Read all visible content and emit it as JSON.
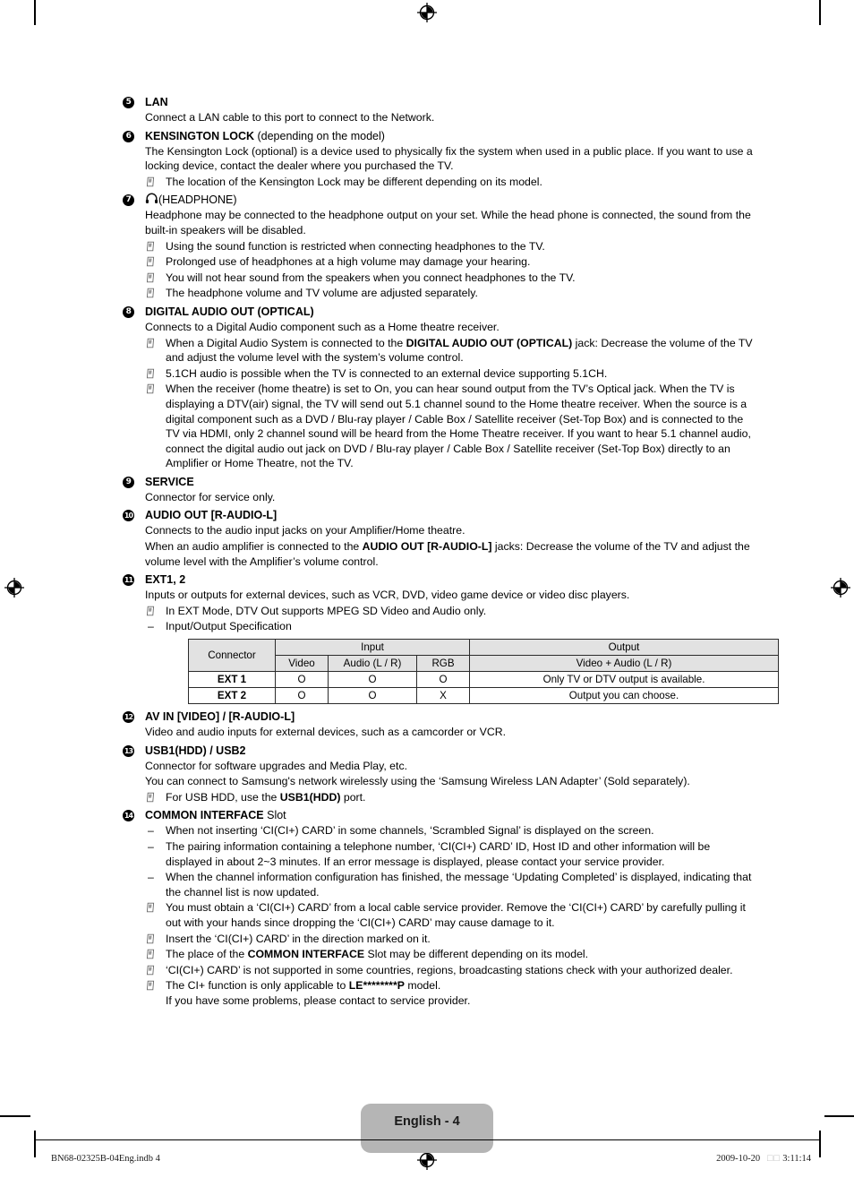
{
  "page": {
    "badge_label": "English - 4",
    "footer_left": "BN68-02325B-04Eng.indb   4",
    "footer_right_date": "2009-10-20",
    "footer_right_time": "3:11:14",
    "footer_right_ampm": "□□"
  },
  "sections": [
    {
      "number": "5",
      "title_bold": "LAN",
      "title_rest": "",
      "lines": [
        {
          "kind": "para",
          "text": "Connect a LAN cable to this port to connect to the Network."
        }
      ]
    },
    {
      "number": "6",
      "title_bold": "KENSINGTON LOCK",
      "title_rest": " (depending on the model)",
      "lines": [
        {
          "kind": "para",
          "text": "The Kensington Lock (optional) is a device used to physically fix the system when used in a public place. If you want to use a locking device, contact the dealer where you purchased the TV."
        },
        {
          "kind": "note",
          "text": "The location of the Kensington Lock may be different depending on its model."
        }
      ]
    },
    {
      "number": "7",
      "title_icon": "headphone-icon",
      "title_bold": "",
      "title_rest": "(HEADPHONE)",
      "lines": [
        {
          "kind": "para",
          "text": "Headphone may be connected to the headphone output on your set. While the head phone is connected, the sound from the built-in speakers will be disabled."
        },
        {
          "kind": "note",
          "text": "Using the sound function is restricted when connecting headphones to the TV."
        },
        {
          "kind": "note",
          "text": "Prolonged use of headphones at a high volume may damage your hearing."
        },
        {
          "kind": "note",
          "text": "You will not hear sound from the speakers when you connect headphones to the TV."
        },
        {
          "kind": "note",
          "text": "The headphone volume and TV volume are adjusted separately."
        }
      ]
    },
    {
      "number": "8",
      "title_bold": "DIGITAL AUDIO OUT (OPTICAL)",
      "title_rest": "",
      "lines": [
        {
          "kind": "para",
          "text": "Connects to a Digital Audio component such as a Home theatre receiver."
        },
        {
          "kind": "note",
          "html": "When a Digital Audio System is connected to the <b>DIGITAL AUDIO OUT (OPTICAL)</b> jack: Decrease the volume of the TV and adjust the volume level with the system’s volume control."
        },
        {
          "kind": "note",
          "text": "5.1CH audio is possible when the TV is connected to an external device supporting 5.1CH."
        },
        {
          "kind": "note",
          "text": "When the receiver (home theatre) is set to On, you can hear sound output from the TV’s Optical jack. When the TV is displaying a DTV(air) signal, the TV will send out 5.1 channel sound to the Home theatre receiver. When the source is a digital component such as a DVD / Blu-ray player / Cable Box / Satellite receiver (Set-Top Box) and is connected to the TV via HDMI, only 2 channel sound will be heard from the Home Theatre receiver. If you want to hear 5.1 channel audio, connect the digital audio out jack on DVD / Blu-ray player / Cable Box / Satellite receiver (Set-Top Box) directly to an Amplifier or Home Theatre, not the TV."
        }
      ]
    },
    {
      "number": "9",
      "title_bold": "SERVICE",
      "title_rest": "",
      "lines": [
        {
          "kind": "para",
          "text": "Connector for service only."
        }
      ]
    },
    {
      "number": "10",
      "title_bold": "AUDIO OUT [R-AUDIO-L]",
      "title_rest": "",
      "lines": [
        {
          "kind": "para",
          "text": "Connects to the audio input jacks on your Amplifier/Home theatre."
        },
        {
          "kind": "para",
          "html": "When an audio amplifier is connected to the <b>AUDIO OUT [R-AUDIO-L]</b> jacks: Decrease the volume of the TV and adjust the volume level with the Amplifier’s volume control."
        }
      ]
    },
    {
      "number": "11",
      "title_bold": "EXT1, 2",
      "title_rest": "",
      "lines": [
        {
          "kind": "para",
          "text": "Inputs or outputs for external devices, such as VCR, DVD, video game device or video disc players."
        },
        {
          "kind": "note",
          "text": "In EXT Mode, DTV Out supports MPEG SD Video and Audio only."
        },
        {
          "kind": "dash",
          "text": "Input/Output Specification"
        },
        {
          "kind": "table"
        }
      ]
    },
    {
      "number": "12",
      "title_bold": "AV IN [VIDEO] / [R-AUDIO-L]",
      "title_rest": "",
      "lines": [
        {
          "kind": "para",
          "text": "Video and audio inputs for external devices, such as a camcorder or VCR."
        }
      ]
    },
    {
      "number": "13",
      "title_bold": "USB1(HDD) / USB2",
      "title_rest": "",
      "lines": [
        {
          "kind": "para",
          "text": "Connector for software upgrades and Media Play, etc."
        },
        {
          "kind": "para",
          "text": "You can connect to Samsung's network wirelessly using the ‘Samsung Wireless LAN Adapter’ (Sold separately)."
        },
        {
          "kind": "note",
          "html": "For USB HDD, use the <b>USB1(HDD)</b> port."
        }
      ]
    },
    {
      "number": "14",
      "title_bold": "COMMON INTERFACE",
      "title_rest": " Slot",
      "lines": [
        {
          "kind": "dash",
          "text": "When not inserting ‘CI(CI+) CARD’ in some channels, ‘Scrambled Signal’ is displayed on the screen."
        },
        {
          "kind": "dash",
          "text": "The pairing information containing a telephone number, ‘CI(CI+) CARD’ ID, Host ID and other information will be displayed in about 2~3 minutes. If an error message is displayed, please contact your service provider."
        },
        {
          "kind": "dash",
          "text": "When the channel information configuration has finished, the message ‘Updating Completed’ is displayed, indicating that the channel list is now updated."
        },
        {
          "kind": "note",
          "text": "You must obtain a ‘CI(CI+) CARD’ from a local cable service provider. Remove the ‘CI(CI+) CARD’ by carefully pulling it out with your hands since dropping the ‘CI(CI+) CARD’ may cause damage to it."
        },
        {
          "kind": "note",
          "text": "Insert the ‘CI(CI+) CARD’ in the direction marked on it."
        },
        {
          "kind": "note",
          "html": "The place of the <b>COMMON INTERFACE</b> Slot may be different depending on its model."
        },
        {
          "kind": "note",
          "text": "‘CI(CI+) CARD’ is not supported in some countries, regions, broadcasting stations check with your authorized dealer."
        },
        {
          "kind": "note",
          "html": "The CI+ function is only applicable to <b>LE********P</b> model.<br>If you have some problems, please contact to service provider."
        }
      ]
    }
  ],
  "spec_table": {
    "group_headers": [
      "Connector",
      "Input",
      "Output"
    ],
    "sub_headers": [
      "Video",
      "Audio (L / R)",
      "RGB",
      "Video + Audio (L / R)"
    ],
    "rows": [
      {
        "connector": "EXT 1",
        "video": "O",
        "audio": "O",
        "rgb": "O",
        "output": "Only TV or DTV output is available."
      },
      {
        "connector": "EXT 2",
        "video": "O",
        "audio": "O",
        "rgb": "X",
        "output": "Output you can choose."
      }
    ]
  }
}
